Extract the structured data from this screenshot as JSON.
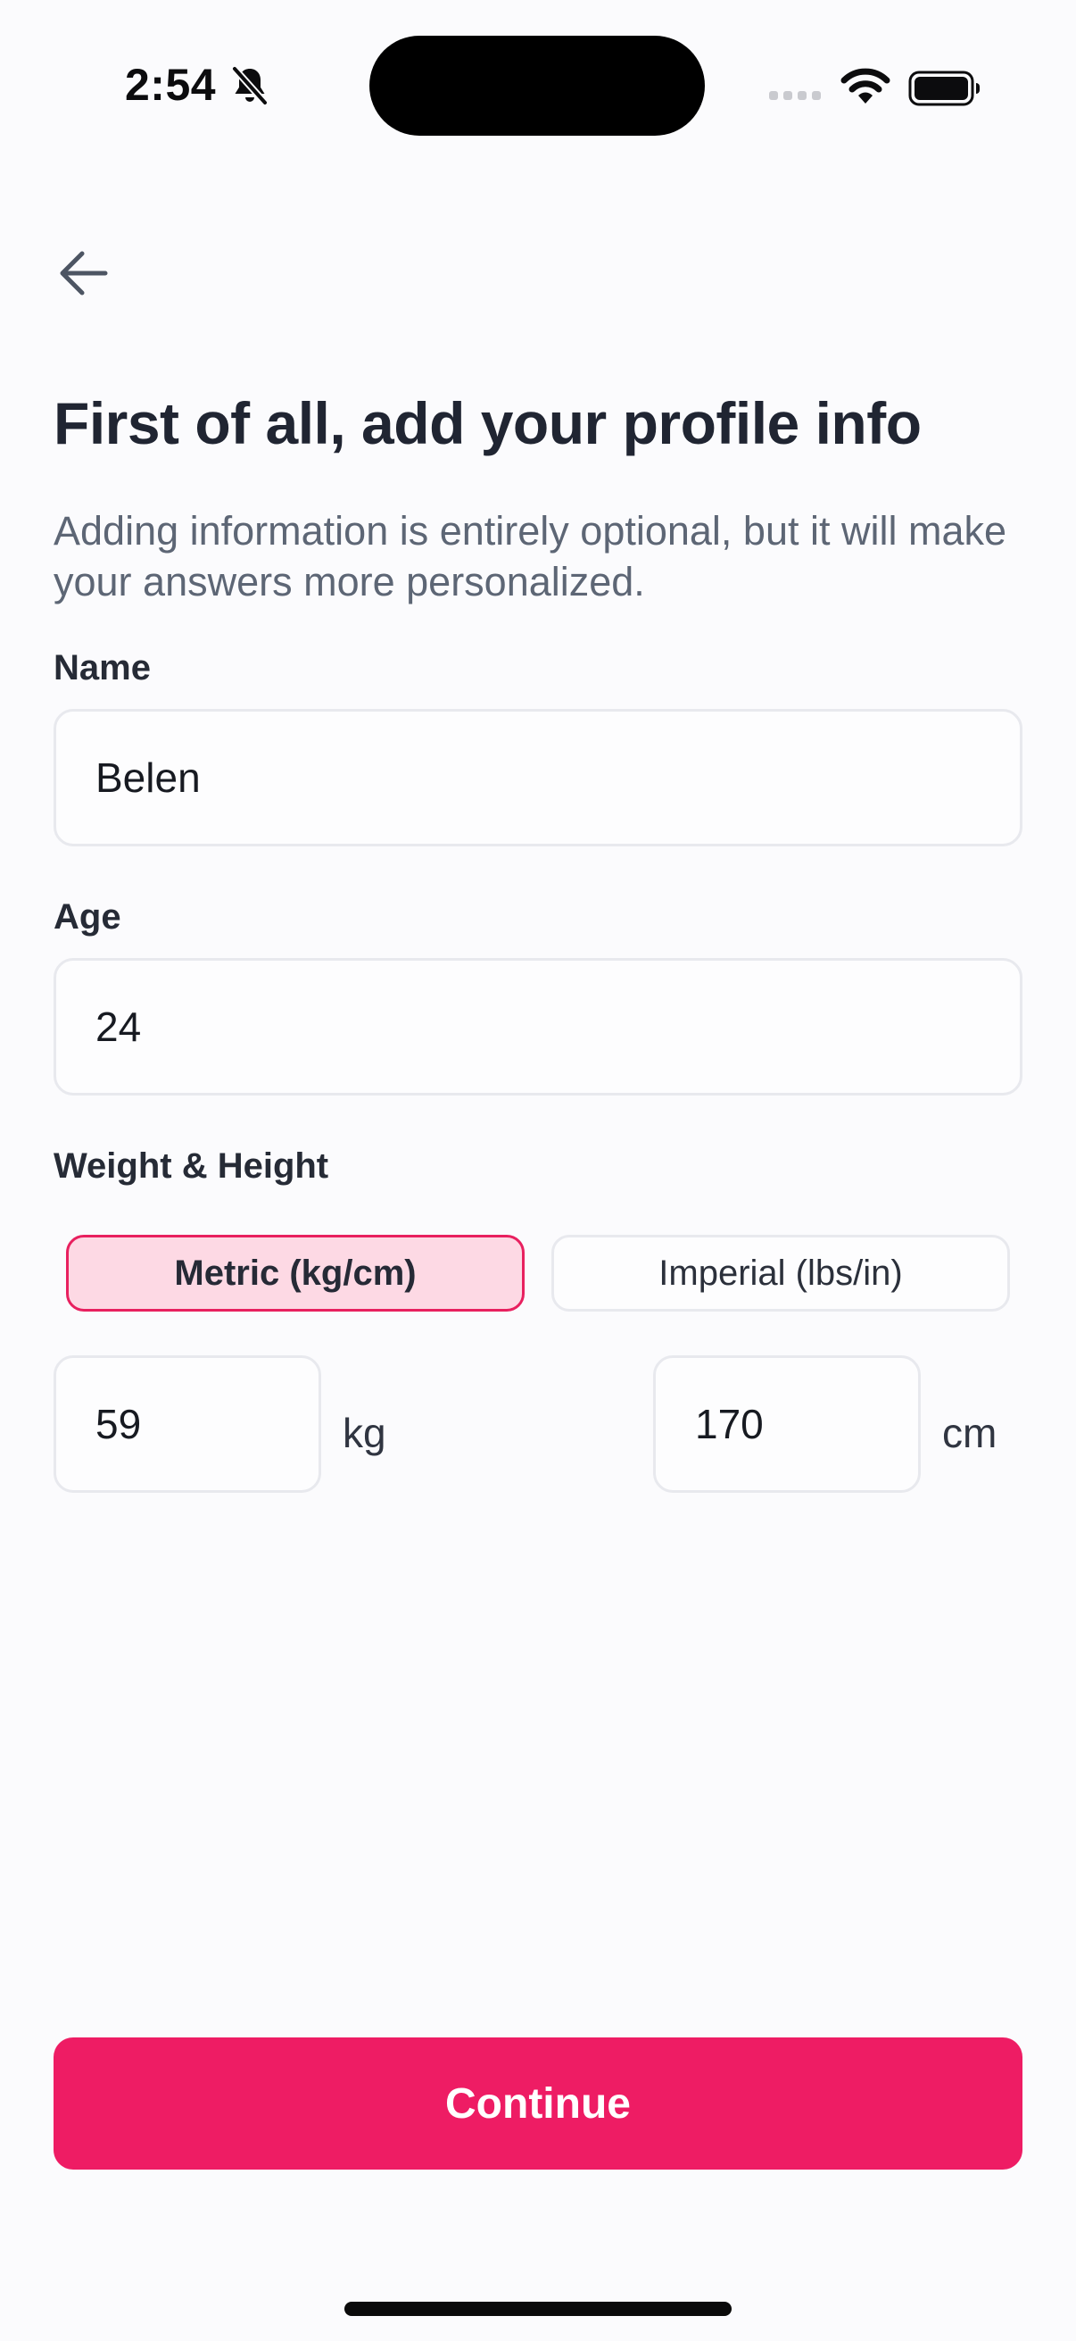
{
  "status_bar": {
    "time": "2:54",
    "icons": [
      "bell-slash-icon",
      "cellular-signal-icon",
      "wifi-icon",
      "battery-icon"
    ]
  },
  "nav": {
    "back_icon": "arrow-left-icon"
  },
  "header": {
    "title": "First of all, add your profile info",
    "subtitle": "Adding information is entirely optional, but it will make your answers more personalized."
  },
  "form": {
    "name": {
      "label": "Name",
      "value": "Belen"
    },
    "age": {
      "label": "Age",
      "value": "24"
    },
    "weight_height": {
      "label": "Weight & Height",
      "units": {
        "metric_label": "Metric (kg/cm)",
        "imperial_label": "Imperial (lbs/in)",
        "selected": "Metric (kg/cm)"
      },
      "weight_value": "59",
      "weight_unit": "kg",
      "height_value": "170",
      "height_unit": "cm"
    }
  },
  "footer": {
    "continue_label": "Continue"
  },
  "colors": {
    "accent": "#ee1c64",
    "accent_soft": "#fdd9e4",
    "background": "#fbfbfd",
    "title_text": "#202532",
    "subtitle_text": "#5d6675"
  }
}
